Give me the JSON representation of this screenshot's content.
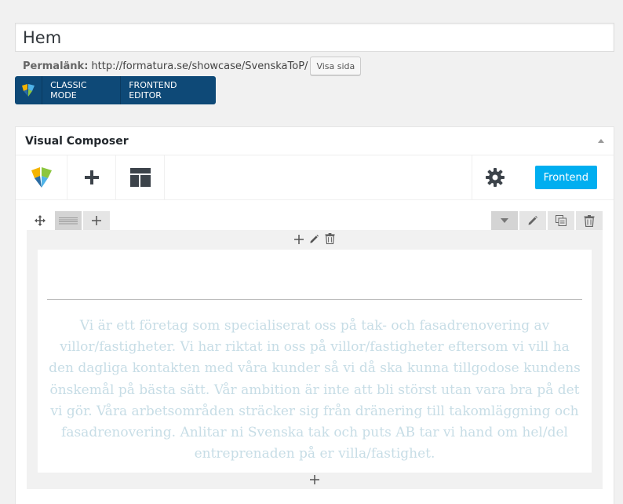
{
  "page": {
    "title_value": "Hem",
    "permalink_label": "Permalänk:",
    "permalink_url": "http://formatura.se/showcase/SvenskaToP/",
    "view_page_label": "Visa sida"
  },
  "mode_bar": {
    "classic_mode_label": "CLASSIC MODE",
    "frontend_editor_label": "FRONTEND EDITOR"
  },
  "visual_composer": {
    "title": "Visual Composer",
    "frontend_button_label": "Frontend",
    "toolbar_icons": [
      "vc-logo-icon",
      "plus-icon",
      "templates-icon",
      "gear-icon"
    ]
  },
  "content": {
    "text_block": "Vi är ett företag som specialiserat oss på tak- och fasadrenovering av villor/fastigheter. Vi har riktat in oss på villor/fastigheter eftersom vi vill ha den dagliga kontakten med våra kunder så vi då ska kunna tillgodose kundens önskemål på bästa sätt. Vår ambition är inte att bli störst utan vara bra på det vi gör. Våra arbetsområden sträcker sig från dränering till takomläggning och fasadrenovering. Anlitar ni Svenska tak och puts AB tar vi hand om hel/del entreprenaden på er villa/fastighet."
  },
  "colors": {
    "accent": "#00aef0",
    "mode_bar": "#0e4977",
    "text_block": "#c7dde6"
  }
}
